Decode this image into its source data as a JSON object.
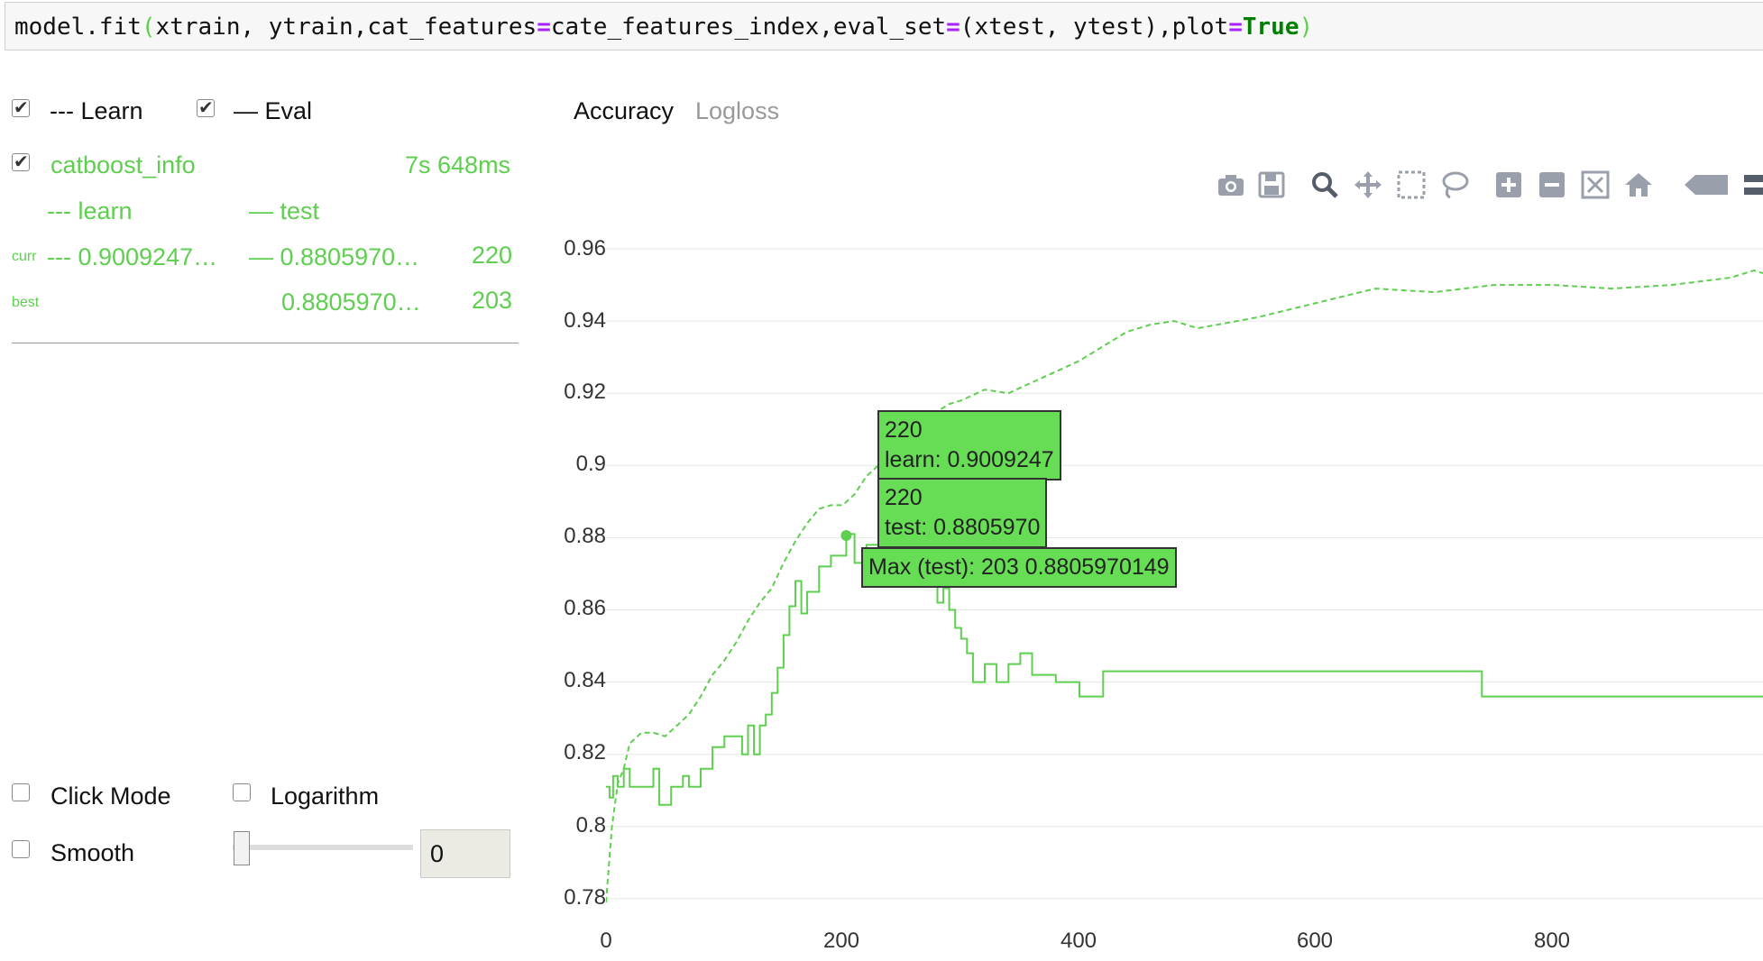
{
  "code": {
    "prefix": "model.fit",
    "open": "(",
    "arg1": "xtrain, ytrain,cat_features",
    "eq1": "=",
    "arg2": "cate_features_index,eval_set",
    "eq2": "=",
    "arg3": "(xtest, ytest),plot",
    "eq3": "=",
    "true_kw": "True",
    "close": ")"
  },
  "legend": {
    "learn_label": "--- Learn",
    "learn_checked": true,
    "eval_label": "— Eval",
    "eval_checked": true
  },
  "info": {
    "name": "catboost_info",
    "checked": true,
    "time": "7s 648ms",
    "col_learn": "--- learn",
    "col_test": "— test",
    "curr_label": "curr",
    "curr_learn": "--- 0.9009247…",
    "curr_test": "— 0.8805970…",
    "curr_iter": "220",
    "best_label": "best",
    "best_test": "0.8805970…",
    "best_iter": "203"
  },
  "metric_tabs": [
    {
      "label": "Accuracy",
      "active": true
    },
    {
      "label": "Logloss",
      "active": false
    }
  ],
  "controls": {
    "click_mode": "Click Mode",
    "logarithm": "Logarithm",
    "smooth": "Smooth",
    "smooth_value": "0"
  },
  "toolbar": [
    "camera-icon",
    "save-icon",
    "zoom-icon",
    "pan-icon",
    "box-select-icon",
    "lasso-icon",
    "zoom-in-icon",
    "zoom-out-icon",
    "autoscale-icon",
    "home-icon",
    "spike-icon",
    "compare-icon"
  ],
  "tooltips": {
    "learn_iter": "220",
    "learn_value": "learn: 0.9009247",
    "test_iter": "220",
    "test_value": "test: 0.8805970",
    "max": "Max (test): 203 0.8805970149"
  },
  "colors": {
    "line": "#5ecf4f",
    "tooltip": "#66dd55"
  },
  "chart_data": {
    "type": "line",
    "title": "",
    "xlabel": "",
    "ylabel": "",
    "xlim": [
      0,
      980
    ],
    "ylim": [
      0.775,
      0.965
    ],
    "x_ticks": [
      "0",
      "200",
      "400",
      "600",
      "800"
    ],
    "y_ticks": [
      "0.96",
      "0.94",
      "0.92",
      "0.9",
      "0.88",
      "0.86",
      "0.84",
      "0.82",
      "0.8",
      "0.78"
    ],
    "grid": true,
    "series": [
      {
        "name": "learn",
        "style": "dashed",
        "x": [
          0,
          5,
          10,
          15,
          20,
          30,
          40,
          50,
          60,
          70,
          80,
          90,
          100,
          110,
          120,
          130,
          140,
          150,
          160,
          170,
          180,
          190,
          200,
          210,
          220,
          230,
          240,
          250,
          260,
          270,
          280,
          290,
          300,
          320,
          340,
          360,
          380,
          400,
          420,
          440,
          460,
          480,
          500,
          550,
          600,
          650,
          700,
          750,
          800,
          850,
          900,
          950,
          970,
          980
        ],
        "y": [
          0.779,
          0.8,
          0.812,
          0.816,
          0.823,
          0.826,
          0.826,
          0.825,
          0.828,
          0.831,
          0.836,
          0.842,
          0.846,
          0.851,
          0.857,
          0.862,
          0.866,
          0.873,
          0.879,
          0.884,
          0.888,
          0.889,
          0.889,
          0.892,
          0.897,
          0.9,
          0.903,
          0.906,
          0.909,
          0.912,
          0.915,
          0.917,
          0.918,
          0.921,
          0.92,
          0.923,
          0.926,
          0.929,
          0.933,
          0.937,
          0.939,
          0.94,
          0.938,
          0.941,
          0.945,
          0.949,
          0.948,
          0.95,
          0.95,
          0.949,
          0.95,
          0.952,
          0.954,
          0.953
        ]
      },
      {
        "name": "test",
        "style": "solid",
        "x": [
          0,
          3,
          6,
          10,
          15,
          20,
          30,
          40,
          45,
          50,
          55,
          60,
          65,
          70,
          80,
          90,
          100,
          110,
          115,
          120,
          125,
          130,
          135,
          140,
          145,
          150,
          155,
          160,
          165,
          170,
          180,
          190,
          203,
          210,
          220,
          230,
          240,
          250,
          260,
          270,
          280,
          285,
          290,
          295,
          300,
          305,
          310,
          320,
          330,
          340,
          350,
          360,
          370,
          380,
          390,
          400,
          410,
          420,
          430,
          500,
          600,
          700,
          730,
          740,
          800,
          900,
          980
        ],
        "y": [
          0.811,
          0.808,
          0.814,
          0.811,
          0.816,
          0.811,
          0.811,
          0.816,
          0.806,
          0.806,
          0.811,
          0.811,
          0.814,
          0.811,
          0.816,
          0.822,
          0.825,
          0.825,
          0.82,
          0.828,
          0.82,
          0.828,
          0.831,
          0.837,
          0.844,
          0.853,
          0.861,
          0.868,
          0.859,
          0.865,
          0.872,
          0.875,
          0.881,
          0.873,
          0.878,
          0.876,
          0.874,
          0.872,
          0.87,
          0.868,
          0.862,
          0.866,
          0.86,
          0.855,
          0.852,
          0.848,
          0.84,
          0.845,
          0.84,
          0.845,
          0.848,
          0.842,
          0.842,
          0.84,
          0.84,
          0.836,
          0.836,
          0.843,
          0.843,
          0.843,
          0.843,
          0.843,
          0.843,
          0.836,
          0.836,
          0.836,
          0.836
        ]
      }
    ]
  }
}
